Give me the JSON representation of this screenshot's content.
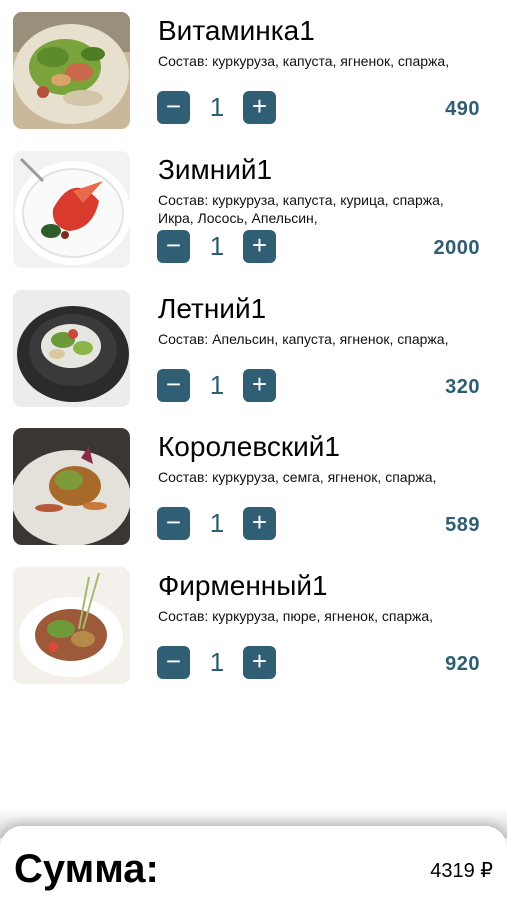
{
  "items": [
    {
      "name": "Витаминка1",
      "composition": "Состав: куркуруза, капуста, ягненок, спаржа,",
      "quantity": "1",
      "price": "490",
      "image": "salad-photo"
    },
    {
      "name": "Зимний1",
      "composition": "Состав: куркуруза, капуста, курица, спаржа, Икра, Лосось, Апельсин,",
      "quantity": "1",
      "price": "2000",
      "image": "salad-photo"
    },
    {
      "name": "Летний1",
      "composition": "Состав: Апельсин, капуста, ягненок, спаржа,",
      "quantity": "1",
      "price": "320",
      "image": "salad-photo"
    },
    {
      "name": "Королевский1",
      "composition": "Состав: куркуруза, семга, ягненок, спаржа,",
      "quantity": "1",
      "price": "589",
      "image": "salad-photo"
    },
    {
      "name": "Фирменный1",
      "composition": "Состав: куркуруза, пюре, ягненок, спаржа,",
      "quantity": "1",
      "price": "920",
      "image": "salad-photo"
    }
  ],
  "controls": {
    "minus_label": "−",
    "plus_label": "+"
  },
  "footer": {
    "sum_label": "Сумма:",
    "sum_value": "4319 ₽"
  },
  "colors": {
    "accent": "#305e74",
    "price": "#2f5e73",
    "background": "#ffffff"
  }
}
